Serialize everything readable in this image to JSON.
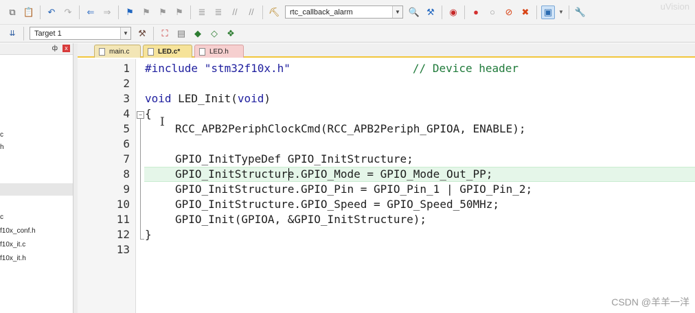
{
  "toolbar1": {
    "callback_combo": "rtc_callback_alarm",
    "icons": [
      "copy-icon",
      "paste-icon",
      "undo-icon",
      "redo-icon",
      "nav-back-icon",
      "nav-forward-icon",
      "bookmark-icon",
      "bookmark-prev-icon",
      "bookmark-next-icon",
      "bookmark-clear-icon",
      "indent-icon",
      "unindent-icon",
      "comment-icon",
      "uncomment-icon",
      "find-in-files-icon",
      "find-icon",
      "debug-start-icon",
      "breakpoint-icon",
      "breakpoint-disable-icon",
      "breakpoint-kill-icon",
      "breakpoint-clear-icon",
      "window-layout-icon",
      "wrench-icon"
    ]
  },
  "toolbar2": {
    "target_combo": "Target 1"
  },
  "project_panel": {
    "pin_glyph": "ф",
    "close_glyph": "x",
    "items": [
      "c",
      "h",
      "c",
      "f10x_conf.h",
      "f10x_it.c",
      "f10x_it.h"
    ]
  },
  "tabs": [
    {
      "label": "main.c",
      "active": false
    },
    {
      "label": "LED.c*",
      "active": true
    },
    {
      "label": "LED.h",
      "active": false
    }
  ],
  "editor": {
    "line_numbers": [
      "1",
      "2",
      "3",
      "4",
      "5",
      "6",
      "7",
      "8",
      "9",
      "10",
      "11",
      "12",
      "13"
    ],
    "current_line": 8,
    "lines": {
      "l1_code": "#include \"stm32f10x.h\"",
      "l1_comment": "// Device header",
      "l3_kw1": "void",
      "l3_name": " LED_Init(",
      "l3_kw2": "void",
      "l3_end": ")",
      "l4": "{",
      "l5": "RCC_APB2PeriphClockCmd(RCC_APB2Periph_GPIOA, ENABLE);",
      "l7": "GPIO_InitTypeDef GPIO_InitStructure;",
      "l8": "GPIO_InitStructure.GPIO_Mode = GPIO_Mode_Out_PP;",
      "l9": "GPIO_InitStructure.GPIO_Pin = GPIO_Pin_1 | GPIO_Pin_2;",
      "l10": "GPIO_InitStructure.GPIO_Speed = GPIO_Speed_50MHz;",
      "l11": "GPIO_Init(GPIOA, &GPIO_InitStructure);",
      "l12": "}"
    }
  },
  "watermark": "CSDN @羊羊一洋",
  "watermark_top": "uVision",
  "colors": {
    "keyword": "#1e1e9e",
    "comment": "#1f7a3a",
    "current_line": "#e5f6e9",
    "tab_active": "#f6e7b0",
    "tab_red": "#f6cfcf"
  }
}
